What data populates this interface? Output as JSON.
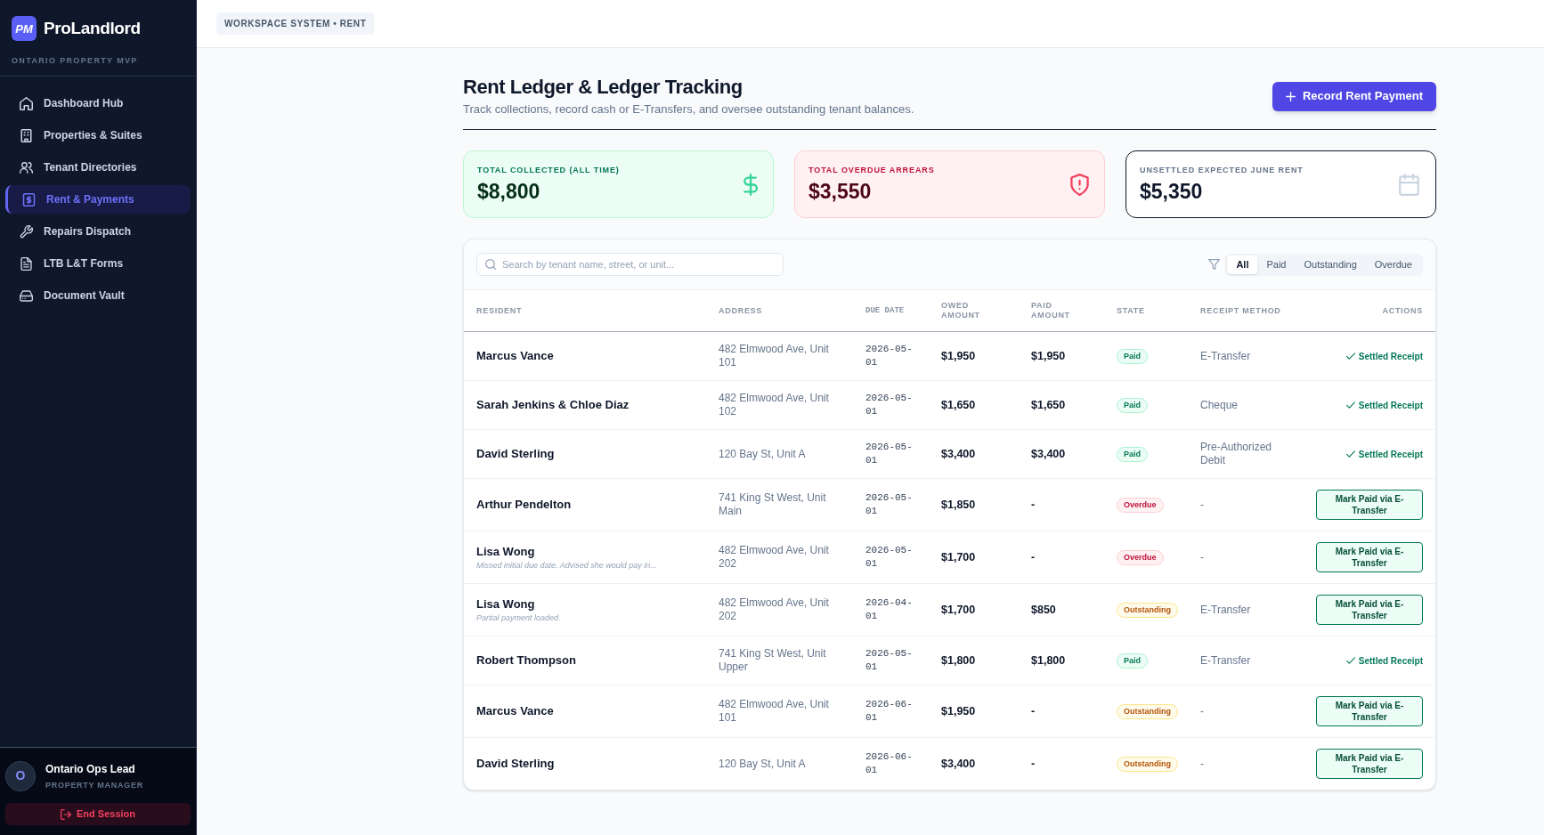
{
  "sidebar": {
    "logo": {
      "badge": "PM",
      "name": "ProLandlord",
      "tagline": "ONTARIO PROPERTY MVP"
    },
    "items": [
      {
        "label": "Dashboard Hub",
        "selected": false
      },
      {
        "label": "Properties & Suites",
        "selected": false
      },
      {
        "label": "Tenant Directories",
        "selected": false
      },
      {
        "label": "Rent & Payments",
        "selected": true
      },
      {
        "label": "Repairs Dispatch",
        "selected": false
      },
      {
        "label": "LTB L&T Forms",
        "selected": false
      },
      {
        "label": "Document Vault",
        "selected": false
      }
    ],
    "user": {
      "initial": "O",
      "name": "Ontario Ops Lead",
      "role": "PROPERTY MANAGER"
    },
    "logout": {
      "label": "End Session"
    }
  },
  "breadcrumb": "WORKSPACE SYSTEM • RENT",
  "header": {
    "title": "Rent Ledger & Ledger Tracking",
    "subtitle": "Track collections, record cash or E-Transfers, and oversee outstanding tenant balances.",
    "action": "Record Rent Payment"
  },
  "stats": [
    {
      "kind": "collected",
      "label": "TOTAL COLLECTED (ALL TIME)",
      "value": "$8,800"
    },
    {
      "kind": "overdue",
      "label": "TOTAL OVERDUE ARREARS",
      "value": "$3,550"
    },
    {
      "kind": "expected",
      "label": "UNSETTLED EXPECTED JUNE RENT",
      "value": "$5,350"
    }
  ],
  "table": {
    "search": {
      "placeholder": "Search by tenant name, street, or unit..."
    },
    "filters": [
      {
        "label": "All",
        "selected": true
      },
      {
        "label": "Paid",
        "selected": false
      },
      {
        "label": "Outstanding",
        "selected": false
      },
      {
        "label": "Overdue",
        "selected": false
      }
    ],
    "columns": [
      "RESIDENT",
      "ADDRESS",
      "DUE DATE",
      "OWED AMOUNT",
      "PAID AMOUNT",
      "STATE",
      "RECEIPT METHOD",
      "ACTIONS"
    ],
    "rows": [
      {
        "resident": "Marcus Vance",
        "address": "482 Elmwood Ave, Unit 101",
        "due_date": "2026-05-01",
        "owed": "$1,950",
        "paid": "$1,950",
        "state": {
          "label": "Paid",
          "kind": "paid"
        },
        "receipt_method": "E-Transfer",
        "action": {
          "kind": "settled",
          "label": "Settled Receipt"
        }
      },
      {
        "resident": "Sarah Jenkins & Chloe Diaz",
        "address": "482 Elmwood Ave, Unit 102",
        "due_date": "2026-05-01",
        "owed": "$1,650",
        "paid": "$1,650",
        "state": {
          "label": "Paid",
          "kind": "paid"
        },
        "receipt_method": "Cheque",
        "action": {
          "kind": "settled",
          "label": "Settled Receipt"
        }
      },
      {
        "resident": "David Sterling",
        "address": "120 Bay St, Unit A",
        "due_date": "2026-05-01",
        "owed": "$3,400",
        "paid": "$3,400",
        "state": {
          "label": "Paid",
          "kind": "paid"
        },
        "receipt_method": "Pre-Authorized Debit",
        "action": {
          "kind": "settled",
          "label": "Settled Receipt"
        }
      },
      {
        "resident": "Arthur Pendelton",
        "address": "741 King St West, Unit Main",
        "due_date": "2026-05-01",
        "owed": "$1,850",
        "paid": "-",
        "state": {
          "label": "Overdue",
          "kind": "overdue"
        },
        "receipt_method": "-",
        "action": {
          "kind": "button",
          "label": "Mark Paid via E-Transfer"
        }
      },
      {
        "resident": "Lisa Wong",
        "note": "Missed initial due date. Advised she would pay in...",
        "address": "482 Elmwood Ave, Unit 202",
        "due_date": "2026-05-01",
        "owed": "$1,700",
        "paid": "-",
        "state": {
          "label": "Overdue",
          "kind": "overdue"
        },
        "receipt_method": "-",
        "action": {
          "kind": "button",
          "label": "Mark Paid via E-Transfer"
        }
      },
      {
        "resident": "Lisa Wong",
        "note": "Partial payment loaded.",
        "address": "482 Elmwood Ave, Unit 202",
        "due_date": "2026-04-01",
        "owed": "$1,700",
        "paid": "$850",
        "state": {
          "label": "Outstanding",
          "kind": "outstanding"
        },
        "receipt_method": "E-Transfer",
        "action": {
          "kind": "button",
          "label": "Mark Paid via E-Transfer"
        }
      },
      {
        "resident": "Robert Thompson",
        "address": "741 King St West, Unit Upper",
        "due_date": "2026-05-01",
        "owed": "$1,800",
        "paid": "$1,800",
        "state": {
          "label": "Paid",
          "kind": "paid"
        },
        "receipt_method": "E-Transfer",
        "action": {
          "kind": "settled",
          "label": "Settled Receipt"
        }
      },
      {
        "resident": "Marcus Vance",
        "address": "482 Elmwood Ave, Unit 101",
        "due_date": "2026-06-01",
        "owed": "$1,950",
        "paid": "-",
        "state": {
          "label": "Outstanding",
          "kind": "outstanding"
        },
        "receipt_method": "-",
        "action": {
          "kind": "button",
          "label": "Mark Paid via E-Transfer"
        }
      },
      {
        "resident": "David Sterling",
        "address": "120 Bay St, Unit A",
        "due_date": "2026-06-01",
        "owed": "$3,400",
        "paid": "-",
        "state": {
          "label": "Outstanding",
          "kind": "outstanding"
        },
        "receipt_method": "-",
        "action": {
          "kind": "button",
          "label": "Mark Paid via E-Transfer"
        }
      }
    ]
  }
}
